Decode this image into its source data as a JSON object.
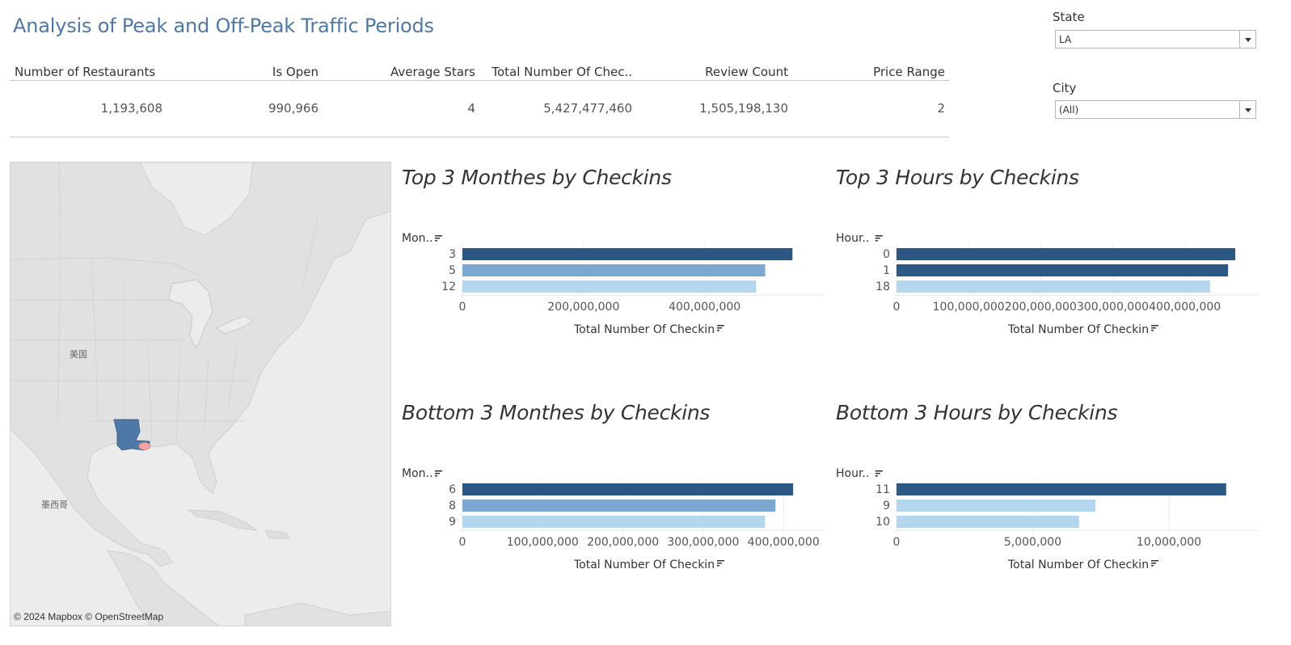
{
  "title": "Analysis of Peak and Off-Peak Traffic Periods",
  "kpis": [
    {
      "label": "Number of Restaurants",
      "value": "1,193,608"
    },
    {
      "label": "Is Open",
      "value": "990,966"
    },
    {
      "label": "Average Stars",
      "value": "4"
    },
    {
      "label": "Total Number Of Chec..",
      "value": "5,427,477,460"
    },
    {
      "label": "Review Count",
      "value": "1,505,198,130"
    },
    {
      "label": "Price Range",
      "value": "2"
    }
  ],
  "filters": {
    "state": {
      "label": "State",
      "value": "LA"
    },
    "city": {
      "label": "City",
      "value": "(All)"
    }
  },
  "map": {
    "labels": [
      "美国",
      "墨西哥"
    ],
    "attribution": "© 2024 Mapbox © OpenStreetMap",
    "highlight_color": "#4e79a7",
    "point_color": "#f4a6a0"
  },
  "chart_data": [
    {
      "type": "bar",
      "title": "Top 3 Monthes by Checkins",
      "ylabel": "Mon..",
      "xlabel": "Total Number Of Checkin",
      "categories": [
        "3",
        "5",
        "12"
      ],
      "values": [
        545000000,
        500000000,
        485000000
      ],
      "colors": [
        "#2c5784",
        "#7ba7d1",
        "#b4d7ef"
      ],
      "xlim": [
        0,
        570000000
      ],
      "xticks": [
        0,
        200000000,
        400000000
      ],
      "xtick_labels": [
        "0",
        "200,000,000",
        "400,000,000"
      ]
    },
    {
      "type": "bar",
      "title": "Top 3 Hours by Checkins",
      "ylabel": "Hour..",
      "xlabel": "Total Number Of Checkin",
      "categories": [
        "0",
        "1",
        "18"
      ],
      "values": [
        470000000,
        460000000,
        435000000
      ],
      "colors": [
        "#2c5784",
        "#2c5784",
        "#b4d7ef"
      ],
      "xlim": [
        0,
        480000000
      ],
      "xticks": [
        0,
        100000000,
        200000000,
        300000000,
        400000000
      ],
      "xtick_labels": [
        "0",
        "100,000,000",
        "200,000,000",
        "300,000,000",
        "400,000,000"
      ]
    },
    {
      "type": "bar",
      "title": "Bottom 3 Monthes by Checkins",
      "ylabel": "Mon..",
      "xlabel": "Total Number Of Checkin",
      "categories": [
        "6",
        "8",
        "9"
      ],
      "values": [
        412000000,
        390000000,
        377000000
      ],
      "colors": [
        "#2c5784",
        "#7ba7d1",
        "#b4d7ef"
      ],
      "xlim": [
        0,
        430000000
      ],
      "xticks": [
        0,
        100000000,
        200000000,
        300000000,
        400000000
      ],
      "xtick_labels": [
        "0",
        "100,000,000",
        "200,000,000",
        "300,000,000",
        "400,000,000"
      ]
    },
    {
      "type": "bar",
      "title": "Bottom 3 Hours by Checkins",
      "ylabel": "Hour..",
      "xlabel": "Total Number Of Checkin",
      "categories": [
        "11",
        "9",
        "10"
      ],
      "values": [
        12100000,
        7300000,
        6700000
      ],
      "colors": [
        "#2c5784",
        "#b4d7ef",
        "#b4d7ef"
      ],
      "xlim": [
        0,
        12700000
      ],
      "xticks": [
        0,
        5000000,
        10000000
      ],
      "xtick_labels": [
        "0",
        "5,000,000",
        "10,000,000"
      ]
    }
  ]
}
